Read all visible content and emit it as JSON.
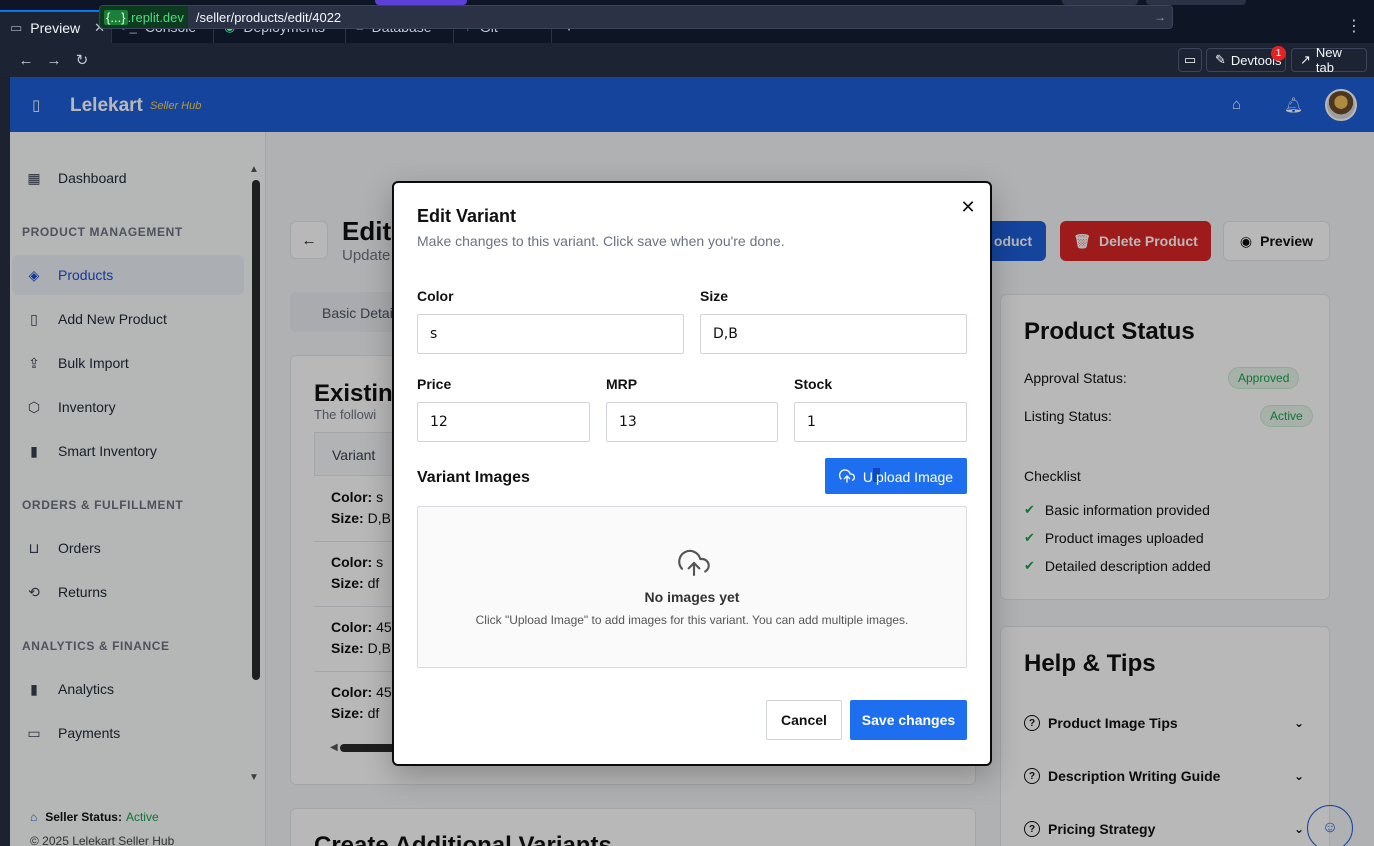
{
  "ide": {
    "tabs": [
      {
        "label": "Preview",
        "icon": "monitor-icon"
      },
      {
        "label": "Console",
        "icon": "terminal-icon"
      },
      {
        "label": "Deployments",
        "icon": "deploy-icon"
      },
      {
        "label": "Database",
        "icon": "database-icon"
      },
      {
        "label": "Git",
        "icon": "git-icon"
      }
    ],
    "url_host_prefix": "{...}",
    "url_host": ".replit.dev",
    "url_path": "/seller/products/edit/4022",
    "devtools_label": "Devtools",
    "devtools_badge": "1",
    "new_tab_label": "New tab"
  },
  "app": {
    "brand": "Lelekart",
    "brand_sub": "Seller Hub",
    "colors": {
      "primary": "#1e5fd9",
      "danger": "#dc2626",
      "success": "#16a34a"
    }
  },
  "sidebar": {
    "dashboard": "Dashboard",
    "section_product": "PRODUCT MANAGEMENT",
    "products": "Products",
    "add_new_product": "Add New Product",
    "bulk_import": "Bulk Import",
    "inventory": "Inventory",
    "smart_inventory": "Smart Inventory",
    "section_orders": "ORDERS & FULFILLMENT",
    "orders": "Orders",
    "returns": "Returns",
    "section_analytics": "ANALYTICS & FINANCE",
    "analytics": "Analytics",
    "payments": "Payments",
    "seller_status_label": "Seller Status:",
    "seller_status_value": "Active",
    "copyright": "© 2025 Lelekart Seller Hub"
  },
  "page": {
    "title": "Edit",
    "subtitle": "Update",
    "btn_update_cut": "oduct",
    "btn_delete": "Delete Product",
    "btn_preview": "Preview",
    "tab_basic": "Basic Detai",
    "existing_title": "Existing",
    "existing_sub": "The followi",
    "table_head": "Variant",
    "rows": [
      {
        "color": "s",
        "size": "D,B"
      },
      {
        "color": "s",
        "size": "df"
      },
      {
        "color": "45",
        "size": "D,B"
      },
      {
        "color": "45",
        "size": "df"
      }
    ],
    "create_title": "Create Additional Variants",
    "color_key": "Color:",
    "size_key": "Size:"
  },
  "status_panel": {
    "title": "Product Status",
    "approval_label": "Approval Status:",
    "approval_value": "Approved",
    "listing_label": "Listing Status:",
    "listing_value": "Active",
    "checklist_title": "Checklist",
    "checklist": [
      "Basic information provided",
      "Product images uploaded",
      "Detailed description added"
    ]
  },
  "help_panel": {
    "title": "Help & Tips",
    "items": [
      "Product Image Tips",
      "Description Writing Guide",
      "Pricing Strategy"
    ]
  },
  "dialog": {
    "title": "Edit Variant",
    "description": "Make changes to this variant. Click save when you're done.",
    "color_label": "Color",
    "color_value": "s",
    "size_label": "Size",
    "size_value": "D,B",
    "price_label": "Price",
    "price_value": "12",
    "mrp_label": "MRP",
    "mrp_value": "13",
    "stock_label": "Stock",
    "stock_value": "1",
    "images_title": "Variant Images",
    "upload_prefix": "U",
    "upload_rest": "pload Image",
    "empty_title": "No images yet",
    "empty_sub": "Click \"Upload Image\" to add images for this variant. You can add multiple images.",
    "cancel": "Cancel",
    "save": "Save changes"
  }
}
